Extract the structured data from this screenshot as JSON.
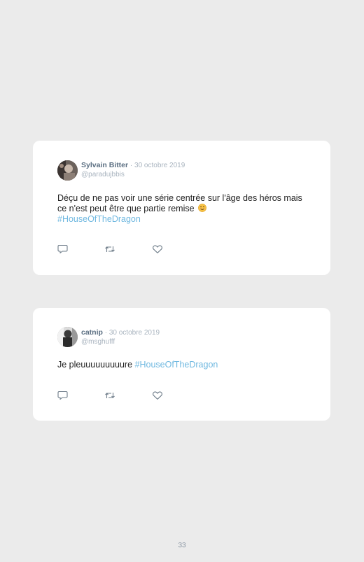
{
  "tweets": [
    {
      "author": "Sylvain Bitter",
      "separator": "·",
      "date": "30 octobre 2019",
      "handle": "@paradujbbis",
      "text": "Déçu de ne pas voir une série centrée sur l'âge des héros mais ce n'est peut être que partie remise",
      "emoji": "smiling-face-emoji",
      "hashtag": "#HouseOfTheDragon"
    },
    {
      "author": "catnip",
      "separator": "·",
      "date": "30 octobre 2019",
      "handle": "@msghufff",
      "text": "Je pleuuuuuuuuure",
      "hashtag": "#HouseOfTheDragon"
    }
  ],
  "icons": {
    "reply": "reply-icon",
    "retweet": "retweet-icon",
    "like": "heart-icon"
  },
  "colors": {
    "background": "#ebebeb",
    "card": "#ffffff",
    "author": "#5b6f82",
    "meta": "#a9b4bf",
    "hashtag": "#6fb8e0",
    "icon": "#6e7c89"
  },
  "page_number": "33"
}
